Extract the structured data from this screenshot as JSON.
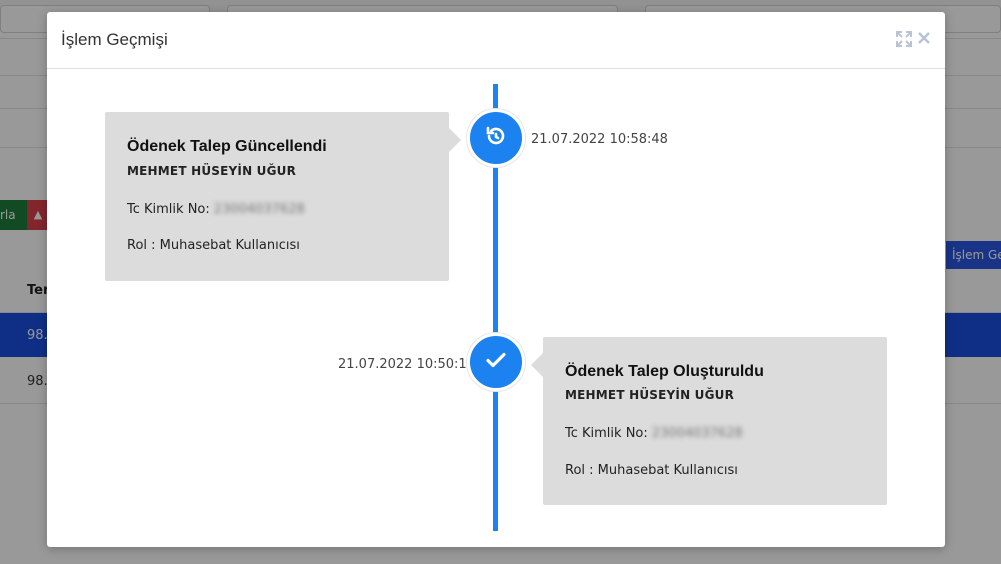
{
  "modal": {
    "title": "İşlem Geçmişi",
    "icons": [
      "expand-icon",
      "close-icon"
    ]
  },
  "background": {
    "green_button_label": "rla",
    "blue_button_label": "İşlem Geç",
    "table_header": "Ter",
    "row1_value": "98.",
    "row2_value": "98."
  },
  "timeline": {
    "line_color": "#1b82f0",
    "events": [
      {
        "icon": "undo-icon",
        "title": "Ödenek Talep Güncellendi",
        "user": "MEHMET HÜSEYİN UĞUR",
        "tc_label": "Tc Kimlik No:",
        "tc_value": "23004037628",
        "role": "Rol : Muhasebat Kullanıcısı",
        "timestamp": "21.07.2022 10:58:48"
      },
      {
        "icon": "check-icon",
        "title": "Ödenek Talep Oluşturuldu",
        "user": "MEHMET HÜSEYİN UĞUR",
        "tc_label": "Tc Kimlik No:",
        "tc_value": "23004037628",
        "role": "Rol : Muhasebat Kullanıcısı",
        "timestamp": "21.07.2022 10:50:19"
      }
    ]
  }
}
